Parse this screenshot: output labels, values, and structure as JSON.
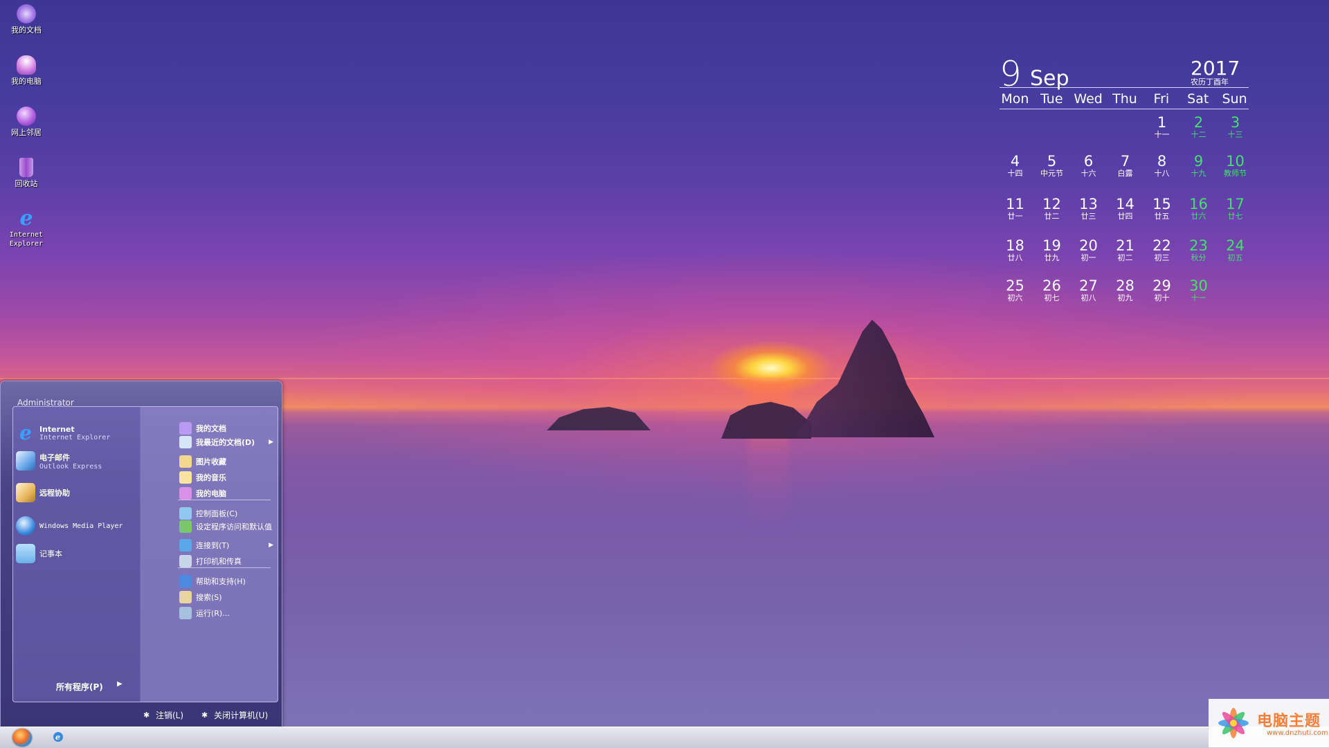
{
  "desktop": {
    "icons": [
      {
        "label": "我的文档",
        "icon": "my-documents-icon"
      },
      {
        "label": "我的电脑",
        "icon": "my-computer-icon"
      },
      {
        "label": "网上邻居",
        "icon": "network-places-icon"
      },
      {
        "label": "回收站",
        "icon": "recycle-bin-icon"
      },
      {
        "label": "Internet Explorer",
        "icon": "internet-explorer-icon"
      }
    ]
  },
  "calendar": {
    "day": "9",
    "month": "Sep",
    "year": "2017",
    "lunar_year": "农历丁酉年",
    "weekdays": [
      "Mon",
      "Tue",
      "Wed",
      "Thu",
      "Fri",
      "Sat",
      "Sun"
    ],
    "weekend_color": "#42e36a",
    "weeks": [
      [
        null,
        null,
        null,
        null,
        {
          "n": "1",
          "l": "十一"
        },
        {
          "n": "2",
          "l": "十二"
        },
        {
          "n": "3",
          "l": "十三"
        }
      ],
      [
        {
          "n": "4",
          "l": "十四"
        },
        {
          "n": "5",
          "l": "中元节"
        },
        {
          "n": "6",
          "l": "十六"
        },
        {
          "n": "7",
          "l": "白露"
        },
        {
          "n": "8",
          "l": "十八"
        },
        {
          "n": "9",
          "l": "十九"
        },
        {
          "n": "10",
          "l": "教师节"
        }
      ],
      [
        {
          "n": "11",
          "l": "廿一"
        },
        {
          "n": "12",
          "l": "廿二"
        },
        {
          "n": "13",
          "l": "廿三"
        },
        {
          "n": "14",
          "l": "廿四"
        },
        {
          "n": "15",
          "l": "廿五"
        },
        {
          "n": "16",
          "l": "廿六"
        },
        {
          "n": "17",
          "l": "廿七"
        }
      ],
      [
        {
          "n": "18",
          "l": "廿八"
        },
        {
          "n": "19",
          "l": "廿九"
        },
        {
          "n": "20",
          "l": "初一"
        },
        {
          "n": "21",
          "l": "初二"
        },
        {
          "n": "22",
          "l": "初三"
        },
        {
          "n": "23",
          "l": "秋分"
        },
        {
          "n": "24",
          "l": "初五"
        }
      ],
      [
        {
          "n": "25",
          "l": "初六"
        },
        {
          "n": "26",
          "l": "初七"
        },
        {
          "n": "27",
          "l": "初八"
        },
        {
          "n": "28",
          "l": "初九"
        },
        {
          "n": "29",
          "l": "初十"
        },
        {
          "n": "30",
          "l": "十一"
        },
        null
      ]
    ]
  },
  "start_menu": {
    "user": "Administrator",
    "left_items": [
      {
        "title": "Internet",
        "sub": "Internet Explorer",
        "icon": "internet-explorer-icon"
      },
      {
        "title": "电子邮件",
        "sub": "Outlook Express",
        "icon": "outlook-express-icon"
      },
      {
        "title": "远程协助",
        "sub": "",
        "icon": "remote-assistance-icon"
      },
      {
        "title": "Windows Media Player",
        "sub": "",
        "icon": "media-player-icon"
      },
      {
        "title": "记事本",
        "sub": "",
        "icon": "notepad-icon"
      }
    ],
    "right_items": [
      {
        "label": "我的文档",
        "icon": "my-documents-icon",
        "bold": true
      },
      {
        "label": "我最近的文档(D)",
        "icon": "recent-documents-icon",
        "bold": true,
        "arrow": true
      },
      {
        "label": "图片收藏",
        "icon": "my-pictures-icon",
        "bold": true
      },
      {
        "label": "我的音乐",
        "icon": "my-music-icon",
        "bold": true
      },
      {
        "label": "我的电脑",
        "icon": "my-computer-icon",
        "bold": true
      },
      {
        "label": "控制面板(C)",
        "icon": "control-panel-icon"
      },
      {
        "label": "设定程序访问和默认值",
        "icon": "program-access-icon"
      },
      {
        "label": "连接到(T)",
        "icon": "connect-to-icon",
        "arrow": true
      },
      {
        "label": "打印机和传真",
        "icon": "printers-faxes-icon"
      },
      {
        "label": "帮助和支持(H)",
        "icon": "help-support-icon"
      },
      {
        "label": "搜索(S)",
        "icon": "search-icon"
      },
      {
        "label": "运行(R)...",
        "icon": "run-icon"
      }
    ],
    "all_programs": "所有程序(P)",
    "logoff": "注销(L)",
    "shutdown": "关闭计算机(U)"
  },
  "watermark": {
    "title": "电脑主题",
    "url": "www.dnzhuti.com"
  }
}
